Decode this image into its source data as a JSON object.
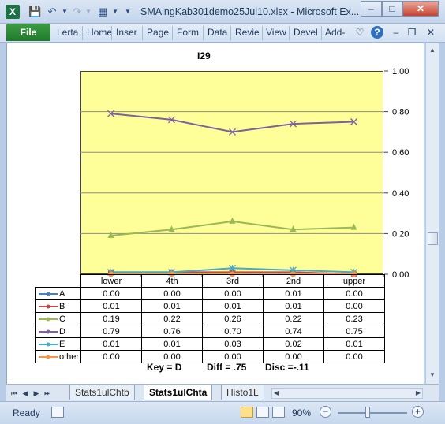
{
  "window": {
    "title": "SMAingKab301demo25Jul10.xlsx - Microsoft Ex...",
    "app_icon": "X",
    "minimize": "–",
    "maximize": "□",
    "close": "✕"
  },
  "ribbon": {
    "file_label": "File",
    "tabs": [
      "Lerta",
      "Home",
      "Inser",
      "Page",
      "Form",
      "Data",
      "Revie",
      "View",
      "Devel",
      "Add-"
    ]
  },
  "chart_data": {
    "type": "line",
    "title": "I29",
    "categories": [
      "lower",
      "4th",
      "3rd",
      "2nd",
      "upper"
    ],
    "ylim": [
      0,
      1
    ],
    "yticks": [
      "0.00",
      "0.20",
      "0.40",
      "0.60",
      "0.80",
      "1.00"
    ],
    "y_axis_side": "right",
    "grid": true,
    "plot_background": "#ffff99",
    "series": [
      {
        "name": "A",
        "color": "#4a7ebb",
        "marker": "diamond",
        "values": [
          "0.00",
          "0.00",
          "0.00",
          "0.01",
          "0.00"
        ]
      },
      {
        "name": "B",
        "color": "#be4b48",
        "marker": "square",
        "values": [
          "0.01",
          "0.01",
          "0.01",
          "0.01",
          "0.00"
        ]
      },
      {
        "name": "C",
        "color": "#98b954",
        "marker": "triangle",
        "values": [
          "0.19",
          "0.22",
          "0.26",
          "0.22",
          "0.23"
        ]
      },
      {
        "name": "D",
        "color": "#7d60a0",
        "marker": "x",
        "values": [
          "0.79",
          "0.76",
          "0.70",
          "0.74",
          "0.75"
        ]
      },
      {
        "name": "E",
        "color": "#46aac5",
        "marker": "star",
        "values": [
          "0.01",
          "0.01",
          "0.03",
          "0.02",
          "0.01"
        ]
      },
      {
        "name": "other",
        "color": "#f79646",
        "marker": "circle",
        "values": [
          "0.00",
          "0.00",
          "0.00",
          "0.00",
          "0.00"
        ]
      }
    ],
    "footer": {
      "key": "Key = D",
      "diff": "Diff = .75",
      "disc": "Disc =-.11"
    }
  },
  "sheets": {
    "tabs": [
      "Stats1ulChtb",
      "Stats1ulChta",
      "Histo1L"
    ],
    "active": "Stats1ulChta"
  },
  "status": {
    "ready": "Ready",
    "zoom": "90%",
    "zoom_minus": "−",
    "zoom_plus": "+"
  }
}
